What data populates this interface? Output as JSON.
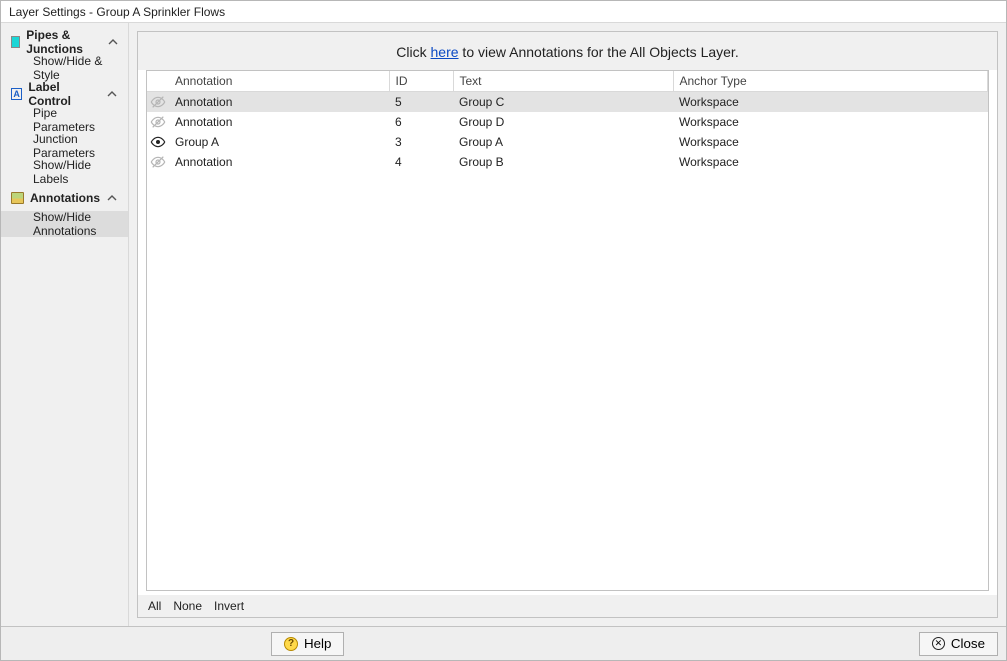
{
  "window": {
    "title": "Layer Settings - Group A Sprinkler Flows"
  },
  "sidebar": {
    "sections": [
      {
        "label": "Pipes & Junctions",
        "items": [
          {
            "label": "Show/Hide & Style"
          }
        ]
      },
      {
        "label": "Label Control",
        "items": [
          {
            "label": "Pipe Parameters"
          },
          {
            "label": "Junction Parameters"
          },
          {
            "label": "Show/Hide Labels"
          }
        ]
      },
      {
        "label": "Annotations",
        "items": [
          {
            "label": "Show/Hide Annotations"
          }
        ]
      }
    ]
  },
  "hint": {
    "prefix": "Click ",
    "link": "here",
    "suffix": " to view Annotations for the All Objects Layer."
  },
  "table": {
    "headers": {
      "annotation": "Annotation",
      "id": "ID",
      "text": "Text",
      "anchor": "Anchor Type"
    },
    "rows": [
      {
        "visible": false,
        "annotation": "Annotation",
        "id": "5",
        "text": "Group C",
        "anchor": "Workspace",
        "selected": true
      },
      {
        "visible": false,
        "annotation": "Annotation",
        "id": "6",
        "text": "Group D",
        "anchor": "Workspace",
        "selected": false
      },
      {
        "visible": true,
        "annotation": "Group A",
        "id": "3",
        "text": "Group A",
        "anchor": "Workspace",
        "selected": false
      },
      {
        "visible": false,
        "annotation": "Annotation",
        "id": "4",
        "text": "Group B",
        "anchor": "Workspace",
        "selected": false
      }
    ]
  },
  "selectBar": {
    "all": "All",
    "none": "None",
    "invert": "Invert"
  },
  "footer": {
    "help": "Help",
    "close": "Close"
  }
}
